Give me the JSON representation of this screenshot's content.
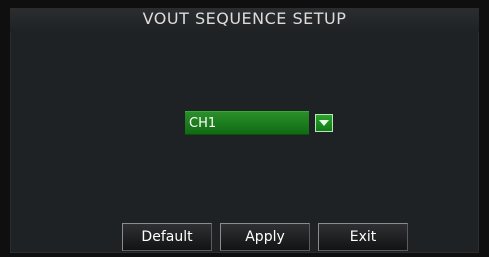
{
  "window": {
    "title": "VOUT SEQUENCE SETUP"
  },
  "channel": {
    "selected": "CH1",
    "dropdown_icon": "chevron-down-icon"
  },
  "buttons": {
    "default_label": "Default",
    "apply_label": "Apply",
    "exit_label": "Exit"
  },
  "colors": {
    "accent_green": "#1f8a22",
    "panel_bg": "#1f2224"
  }
}
